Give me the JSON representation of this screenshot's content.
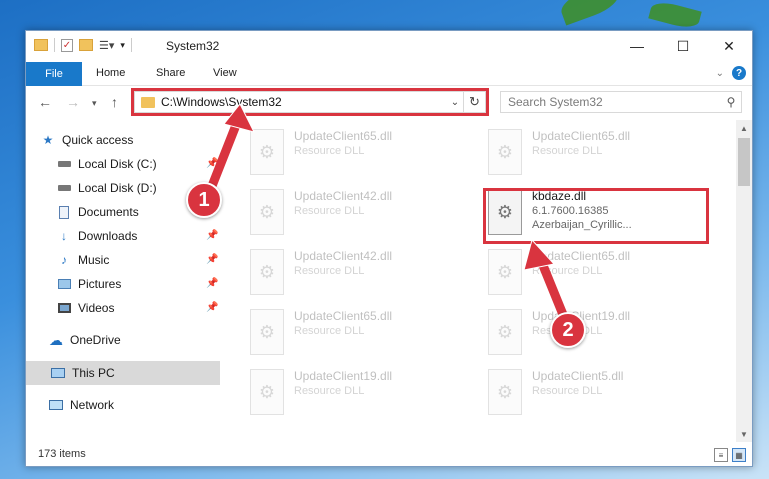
{
  "window": {
    "title": "System32",
    "controls": {
      "minimize": "—",
      "maximize": "☐",
      "close": "✕"
    }
  },
  "ribbon": {
    "file_tab": "File",
    "tabs": [
      "Home",
      "Share",
      "View"
    ]
  },
  "address": {
    "path": "C:\\Windows\\System32"
  },
  "search": {
    "placeholder": "Search System32"
  },
  "sidebar": {
    "items": [
      {
        "label": "Quick access",
        "icon": "star-icon"
      },
      {
        "label": "Local Disk (C:)",
        "icon": "drive-icon",
        "pinned": true
      },
      {
        "label": "Local Disk (D:)",
        "icon": "drive-icon"
      },
      {
        "label": "Documents",
        "icon": "documents-icon"
      },
      {
        "label": "Downloads",
        "icon": "downloads-icon",
        "pinned": true
      },
      {
        "label": "Music",
        "icon": "music-icon",
        "pinned": true
      },
      {
        "label": "Pictures",
        "icon": "pictures-icon",
        "pinned": true
      },
      {
        "label": "Videos",
        "icon": "videos-icon",
        "pinned": true
      },
      {
        "label": "OneDrive",
        "icon": "cloud-icon"
      },
      {
        "label": "This PC",
        "icon": "computer-icon",
        "selected": true
      },
      {
        "label": "Network",
        "icon": "network-icon"
      }
    ]
  },
  "files": [
    {
      "name": "UpdateClient65.dll",
      "type": "Resource DLL"
    },
    {
      "name": "UpdateClient65.dll",
      "type": "Resource DLL"
    },
    {
      "name": "UpdateClient42.dll",
      "type": "Resource DLL"
    },
    {
      "name": "kbdaze.dll",
      "version": "6.1.7600.16385",
      "desc": "Azerbaijan_Cyrillic...",
      "highlighted": true
    },
    {
      "name": "UpdateClient42.dll",
      "type": "Resource DLL"
    },
    {
      "name": "UpdateClient65.dll",
      "type": "Resource DLL"
    },
    {
      "name": "UpdateClient65.dll",
      "type": "Resource DLL"
    },
    {
      "name": "UpdateClient19.dll",
      "type": "Resource DLL"
    },
    {
      "name": "UpdateClient19.dll",
      "type": "Resource DLL"
    },
    {
      "name": "UpdateClient5.dll",
      "type": "Resource DLL"
    }
  ],
  "status": {
    "item_count": "173 items"
  },
  "callouts": {
    "one": "1",
    "two": "2",
    "color": "#d9343f"
  }
}
